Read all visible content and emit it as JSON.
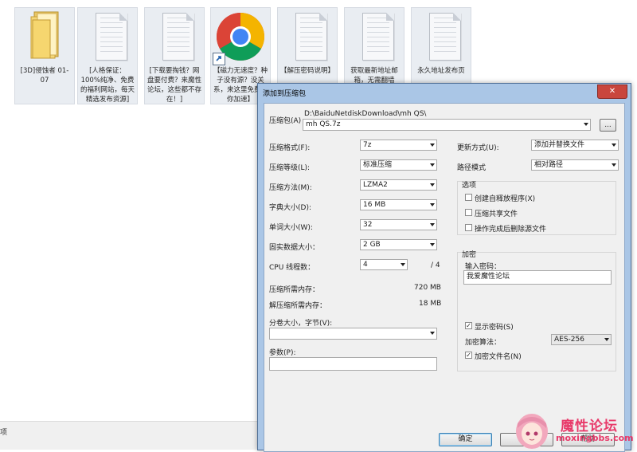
{
  "files": [
    {
      "label": "[3D]侵蚀者 01-07",
      "icon": "folder-icon"
    },
    {
      "label": "[人格保证：100%纯净、免费的福利网站，每天精选发布资源]",
      "icon": "document-icon"
    },
    {
      "label": "[下载要掏钱？网盘要付费？来魔性论坛，这些都不存在！]",
      "icon": "document-icon"
    },
    {
      "label": "【磁力无速度？种子没有源？没关系，来这里免费帮你加速】",
      "icon": "chrome-icon"
    },
    {
      "label": "【解压密码说明】",
      "icon": "document-icon"
    },
    {
      "label": "获取最新地址邮箱，无需翻墙",
      "icon": "document-icon"
    },
    {
      "label": "永久地址发布页",
      "icon": "document-icon"
    }
  ],
  "status_left": "项",
  "dialog": {
    "title": "添加到压缩包",
    "close": "✕",
    "archive_label": "压缩包(A)",
    "archive_path": "D:\\BaiduNetdiskDownload\\mh QS\\",
    "archive_name": "mh QS.7z",
    "browse_label": "...",
    "format_label": "压缩格式(F):",
    "format_value": "7z",
    "level_label": "压缩等级(L):",
    "level_value": "标准压缩",
    "method_label": "压缩方法(M):",
    "method_value": "LZMA2",
    "dict_label": "字典大小(D):",
    "dict_value": "16 MB",
    "word_label": "单词大小(W):",
    "word_value": "32",
    "solid_label": "固实数据大小：",
    "solid_value": "2 GB",
    "cpu_label": "CPU 线程数：",
    "cpu_value": "4",
    "cpu_total": "/ 4",
    "mem_comp_label": "压缩所需内存：",
    "mem_comp_value": "720 MB",
    "mem_decomp_label": "解压缩所需内存：",
    "mem_decomp_value": "18 MB",
    "volume_label": "分卷大小，字节(V):",
    "volume_value": "",
    "params_label": "参数(P):",
    "params_value": "",
    "update_label": "更新方式(U):",
    "update_value": "添加并替换文件",
    "path_label": "路径模式",
    "path_value": "相对路径",
    "options_title": "选项",
    "opt_sfx": "创建自释放程序(X)",
    "opt_shared": "压缩共享文件",
    "opt_delete": "操作完成后删除源文件",
    "enc_title": "加密",
    "pwd_label": "输入密码：",
    "pwd_value": "我爱魔性论坛",
    "show_pwd": "显示密码(S)",
    "enc_method_label": "加密算法：",
    "enc_method_value": "AES-256",
    "enc_names": "加密文件名(N)",
    "ok": "确定",
    "cancel": "取消",
    "help": "帮助"
  },
  "watermark": {
    "name": "魔性论坛",
    "url": "moxingbbs.com"
  }
}
